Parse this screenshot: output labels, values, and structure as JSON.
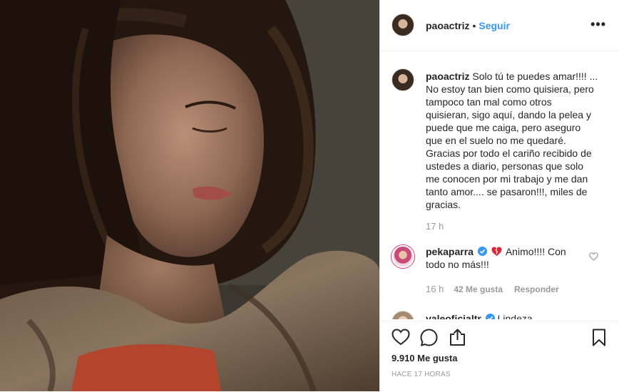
{
  "post": {
    "author": "paoactriz",
    "follow_label": "Seguir",
    "dot": "•",
    "more_label": "•••"
  },
  "caption": {
    "author": "paoactriz",
    "lines": [
      "Solo tú te puedes amar!!!! ...",
      "No estoy tan bien como quisiera, pero",
      "tampoco tan mal como otros",
      "quisieran, sigo aquí, dando la pelea y",
      "puede que me caiga, pero aseguro",
      "que en el suelo no me quedaré.",
      "Gracias por todo el cariño recibido de",
      "ustedes a diario, personas que solo",
      "me conocen por mi trabajo y me dan",
      "tanto amor.... se pasaron!!!, miles de",
      "gracias."
    ],
    "time": "17 h"
  },
  "comments": [
    {
      "author": "pekaparra",
      "text_line1": "Animo!!!! Con",
      "text_line2": "todo no más!!!",
      "time": "16 h",
      "likes": "42 Me gusta",
      "reply_label": "Responder"
    },
    {
      "author": "valeoficialtr",
      "text_partial": "Lindeza"
    }
  ],
  "footer": {
    "likes": "9.910 Me gusta",
    "time_ago": "HACE 17 HORAS"
  },
  "icons": {
    "like": "heart-outline-icon",
    "comment": "comment-bubble-icon",
    "share": "share-icon",
    "save": "bookmark-icon",
    "verified": "verified-badge-icon",
    "broken_heart": "broken-heart-emoji",
    "comment_like": "heart-small-icon"
  },
  "colors": {
    "link": "#3897f0",
    "verified": "#3897f0",
    "text": "#262626",
    "muted": "#999999",
    "broken_heart": "#d9263a"
  }
}
